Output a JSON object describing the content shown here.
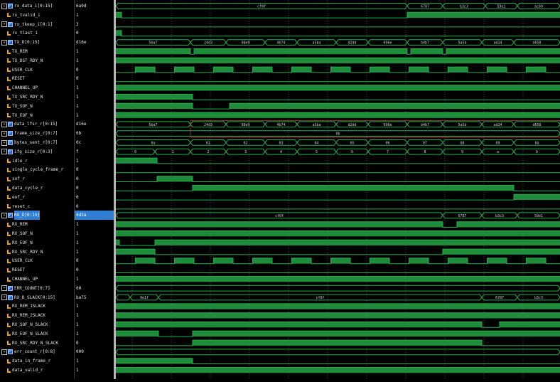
{
  "signals": [
    {
      "name": "rx_data_i[0:15]",
      "value": "6a9d",
      "kind": "bus",
      "icon": "bus-icon"
    },
    {
      "name": "rx_tvalid_i",
      "value": "1",
      "kind": "bit",
      "icon": "signal-icon"
    },
    {
      "name": "rx_tkeep_i[0:1]",
      "value": "3",
      "kind": "bus",
      "icon": "bus-icon"
    },
    {
      "name": "rx_tlast_i",
      "value": "0",
      "kind": "bit",
      "icon": "signal-icon"
    },
    {
      "name": "TX_D[0:15]",
      "value": "d16e",
      "kind": "bus",
      "icon": "bus-icon"
    },
    {
      "name": "TX_REM",
      "value": "1",
      "kind": "bit",
      "icon": "signal-icon"
    },
    {
      "name": "TX_DST_RDY_N",
      "value": "1",
      "kind": "bit",
      "icon": "signal-icon"
    },
    {
      "name": "USER_CLK",
      "value": "0",
      "kind": "bit",
      "icon": "signal-icon"
    },
    {
      "name": "RESET",
      "value": "0",
      "kind": "bit",
      "icon": "signal-icon"
    },
    {
      "name": "CHANNEL_UP",
      "value": "1",
      "kind": "bit",
      "icon": "signal-icon"
    },
    {
      "name": "TX_SRC_RDY_N",
      "value": "1",
      "kind": "bit",
      "icon": "signal-icon"
    },
    {
      "name": "TX_SOF_N",
      "value": "1",
      "kind": "bit",
      "icon": "signal-icon"
    },
    {
      "name": "TX_EOF_N",
      "value": "1",
      "kind": "bit",
      "icon": "signal-icon"
    },
    {
      "name": "data_lfsr_r[0:15]",
      "value": "d16e",
      "kind": "bus",
      "icon": "bus-icon"
    },
    {
      "name": "frame_size_r[0:7]",
      "value": "0b",
      "kind": "bus",
      "icon": "bus-icon"
    },
    {
      "name": "bytes_sent_r[0:7]",
      "value": "0c",
      "kind": "bus",
      "icon": "bus-icon"
    },
    {
      "name": "ifg_size_r[0:3]",
      "value": "f",
      "kind": "bus",
      "icon": "bus-icon"
    },
    {
      "name": "idle_r",
      "value": "1",
      "kind": "bit",
      "icon": "signal-icon"
    },
    {
      "name": "single_cycle_frame_r",
      "value": "0",
      "kind": "bit",
      "icon": "signal-icon"
    },
    {
      "name": "sof_r",
      "value": "0",
      "kind": "bit",
      "icon": "signal-icon"
    },
    {
      "name": "data_cycle_r",
      "value": "0",
      "kind": "bit",
      "icon": "signal-icon"
    },
    {
      "name": "eof_r",
      "value": "0",
      "kind": "bit",
      "icon": "signal-icon"
    },
    {
      "name": "reset_c",
      "value": "0",
      "kind": "bit",
      "icon": "signal-icon"
    },
    {
      "name": "RX_D[0:15]",
      "value": "4d3a",
      "kind": "bus",
      "icon": "bus-icon",
      "selected": true
    },
    {
      "name": "RX_REM",
      "value": "1",
      "kind": "bit",
      "icon": "signal-icon"
    },
    {
      "name": "RX_SOF_N",
      "value": "1",
      "kind": "bit",
      "icon": "signal-icon"
    },
    {
      "name": "RX_EOF_N",
      "value": "1",
      "kind": "bit",
      "icon": "signal-icon"
    },
    {
      "name": "RX_SRC_RDY_N",
      "value": "1",
      "kind": "bit",
      "icon": "signal-icon"
    },
    {
      "name": "USER_CLK",
      "value": "0",
      "kind": "bit",
      "icon": "signal-icon"
    },
    {
      "name": "RESET",
      "value": "0",
      "kind": "bit",
      "icon": "signal-icon"
    },
    {
      "name": "CHANNEL_UP",
      "value": "1",
      "kind": "bit",
      "icon": "signal-icon"
    },
    {
      "name": "ERR_COUNT[0:7]",
      "value": "00",
      "kind": "bus",
      "icon": "bus-icon"
    },
    {
      "name": "RX_D_SLACK[0:15]",
      "value": "ba75",
      "kind": "bus",
      "icon": "bus-icon"
    },
    {
      "name": "RX_REM_1SLACK",
      "value": "1",
      "kind": "bit",
      "icon": "signal-icon"
    },
    {
      "name": "RX_REM_2SLACK",
      "value": "1",
      "kind": "bit",
      "icon": "signal-icon"
    },
    {
      "name": "RX_SOF_N_SLACK",
      "value": "1",
      "kind": "bit",
      "icon": "signal-icon"
    },
    {
      "name": "RX_EOF_N_SLACK",
      "value": "1",
      "kind": "bit",
      "icon": "signal-icon"
    },
    {
      "name": "RX_SRC_RDY_N_SLACK",
      "value": "0",
      "kind": "bit",
      "icon": "signal-icon"
    },
    {
      "name": "err_count_r[0:8]",
      "value": "000",
      "kind": "bus",
      "icon": "bus-icon"
    },
    {
      "name": "data_in_frame_r",
      "value": "1",
      "kind": "bit",
      "icon": "signal-icon"
    },
    {
      "name": "data_valid_r",
      "value": "1",
      "kind": "bit",
      "icon": "signal-icon"
    }
  ],
  "colors": {
    "wave": "#22b14c",
    "fill": "#1e8c3a",
    "bus_text": "#d0d0d0",
    "selection": "#2f7fd6",
    "cursor_box": "#c83232",
    "grid": "#e0e0e0"
  },
  "waves": [
    {
      "type": "bus",
      "segments": [
        [
          0,
          410,
          "cf0f"
        ],
        [
          410,
          460,
          "6787"
        ],
        [
          460,
          520,
          "b3c3"
        ],
        [
          520,
          565,
          "59e1"
        ],
        [
          565,
          625,
          "ac69"
        ]
      ]
    },
    {
      "type": "bit",
      "init": 1,
      "edges": [
        [
          8,
          0
        ],
        [
          410,
          1
        ]
      ]
    },
    {
      "type": "line"
    },
    {
      "type": "bit",
      "init": 1,
      "edges": [
        [
          8,
          0
        ]
      ]
    },
    {
      "type": "bus",
      "segments": [
        [
          0,
          105,
          "5ba7"
        ],
        [
          105,
          155,
          "24d3"
        ],
        [
          155,
          210,
          "98e9"
        ],
        [
          210,
          255,
          "4b74"
        ],
        [
          255,
          310,
          "a5ba"
        ],
        [
          310,
          355,
          "d2dd"
        ],
        [
          355,
          410,
          "696e"
        ],
        [
          410,
          460,
          "b4b7"
        ],
        [
          460,
          515,
          "5a5b"
        ],
        [
          515,
          560,
          "ad24"
        ],
        [
          560,
          625,
          "d658"
        ]
      ]
    },
    {
      "type": "bit",
      "init": 1,
      "edges": [
        [
          105,
          0
        ],
        [
          110,
          1
        ],
        [
          410,
          0
        ],
        [
          415,
          1
        ],
        [
          460,
          0
        ],
        [
          465,
          1
        ]
      ]
    },
    {
      "type": "bit",
      "init": 1,
      "edges": []
    },
    {
      "type": "clock",
      "period": 55,
      "offset": 0
    },
    {
      "type": "bit",
      "init": 0,
      "edges": []
    },
    {
      "type": "bit",
      "init": 1,
      "edges": []
    },
    {
      "type": "bit",
      "init": 1,
      "edges": [
        [
          108,
          0
        ]
      ]
    },
    {
      "type": "bit",
      "init": 1,
      "edges": [
        [
          108,
          0
        ],
        [
          160,
          1
        ]
      ]
    },
    {
      "type": "bit",
      "init": 1,
      "edges": [
        [
          108,
          1
        ]
      ]
    },
    {
      "type": "bus",
      "segments": [
        [
          0,
          105,
          "5ba7"
        ],
        [
          105,
          155,
          "24d3"
        ],
        [
          155,
          210,
          "98e9"
        ],
        [
          210,
          255,
          "4b74"
        ],
        [
          255,
          310,
          "a5ba"
        ],
        [
          310,
          355,
          "d2dd"
        ],
        [
          355,
          410,
          "696e"
        ],
        [
          410,
          460,
          "b4b7"
        ],
        [
          460,
          515,
          "5a5b"
        ],
        [
          515,
          560,
          "ad24"
        ],
        [
          560,
          625,
          "d658"
        ]
      ]
    },
    {
      "type": "bus",
      "segments": [
        [
          0,
          625,
          "0b"
        ]
      ]
    },
    {
      "type": "bus",
      "segments": [
        [
          0,
          105,
          "0a"
        ],
        [
          105,
          155,
          "01"
        ],
        [
          155,
          210,
          "02"
        ],
        [
          210,
          255,
          "03"
        ],
        [
          255,
          310,
          "04"
        ],
        [
          310,
          355,
          "05"
        ],
        [
          355,
          410,
          "06"
        ],
        [
          410,
          460,
          "07"
        ],
        [
          460,
          515,
          "08"
        ],
        [
          515,
          560,
          "09"
        ],
        [
          560,
          625,
          "0a"
        ]
      ]
    },
    {
      "type": "bus",
      "segments": [
        [
          0,
          55,
          "0"
        ],
        [
          55,
          105,
          "1"
        ],
        [
          105,
          155,
          "2"
        ],
        [
          155,
          210,
          "3"
        ],
        [
          210,
          255,
          "4"
        ],
        [
          255,
          310,
          "5"
        ],
        [
          310,
          355,
          "6"
        ],
        [
          355,
          410,
          "7"
        ],
        [
          410,
          460,
          "8"
        ],
        [
          460,
          515,
          "9"
        ],
        [
          515,
          560,
          "a"
        ],
        [
          560,
          625,
          "b"
        ]
      ]
    },
    {
      "type": "bit",
      "init": 1,
      "edges": [
        [
          58,
          0
        ]
      ]
    },
    {
      "type": "bit",
      "init": 0,
      "edges": []
    },
    {
      "type": "bit",
      "init": 0,
      "edges": [
        [
          58,
          1
        ],
        [
          108,
          0
        ]
      ]
    },
    {
      "type": "bit",
      "init": 0,
      "edges": [
        [
          108,
          1
        ],
        [
          560,
          0
        ]
      ]
    },
    {
      "type": "bit",
      "init": 0,
      "edges": [
        [
          560,
          1
        ]
      ]
    },
    {
      "type": "bit",
      "init": 0,
      "edges": []
    },
    {
      "type": "bus",
      "segments": [
        [
          0,
          460,
          "cf0f"
        ],
        [
          460,
          515,
          "6787"
        ],
        [
          515,
          565,
          "b3c3"
        ],
        [
          565,
          625,
          "59e1"
        ]
      ]
    },
    {
      "type": "bit",
      "init": 1,
      "edges": [
        [
          460,
          0
        ],
        [
          480,
          1
        ]
      ]
    },
    {
      "type": "bit",
      "init": 1,
      "edges": []
    },
    {
      "type": "bit",
      "init": 1,
      "edges": [
        [
          5,
          0
        ],
        [
          55,
          1
        ]
      ]
    },
    {
      "type": "bit",
      "init": 1,
      "edges": [
        [
          55,
          0
        ],
        [
          460,
          1
        ]
      ]
    },
    {
      "type": "clock",
      "period": 55,
      "offset": 0
    },
    {
      "type": "bit",
      "init": 0,
      "edges": []
    },
    {
      "type": "bit",
      "init": 1,
      "edges": []
    },
    {
      "type": "bus",
      "segments": [
        [
          0,
          625,
          ""
        ]
      ]
    },
    {
      "type": "bus",
      "segments": [
        [
          0,
          20,
          ""
        ],
        [
          20,
          60,
          "9e1f"
        ],
        [
          60,
          515,
          "cf0f"
        ],
        [
          515,
          565,
          "6787"
        ],
        [
          565,
          625,
          "b3c3"
        ]
      ]
    },
    {
      "type": "bit",
      "init": 1,
      "edges": []
    },
    {
      "type": "bit",
      "init": 1,
      "edges": []
    },
    {
      "type": "bit",
      "init": 1,
      "edges": [
        [
          515,
          0
        ],
        [
          540,
          1
        ]
      ]
    },
    {
      "type": "bit",
      "init": 1,
      "edges": [
        [
          60,
          0
        ],
        [
          108,
          1
        ]
      ]
    },
    {
      "type": "bit",
      "init": 0,
      "edges": [
        [
          108,
          1
        ],
        [
          515,
          0
        ]
      ]
    },
    {
      "type": "bus",
      "segments": [
        [
          0,
          625,
          ""
        ]
      ]
    },
    {
      "type": "bit",
      "init": 1,
      "edges": [
        [
          108,
          0
        ]
      ]
    },
    {
      "type": "bit",
      "init": 1,
      "edges": []
    }
  ]
}
